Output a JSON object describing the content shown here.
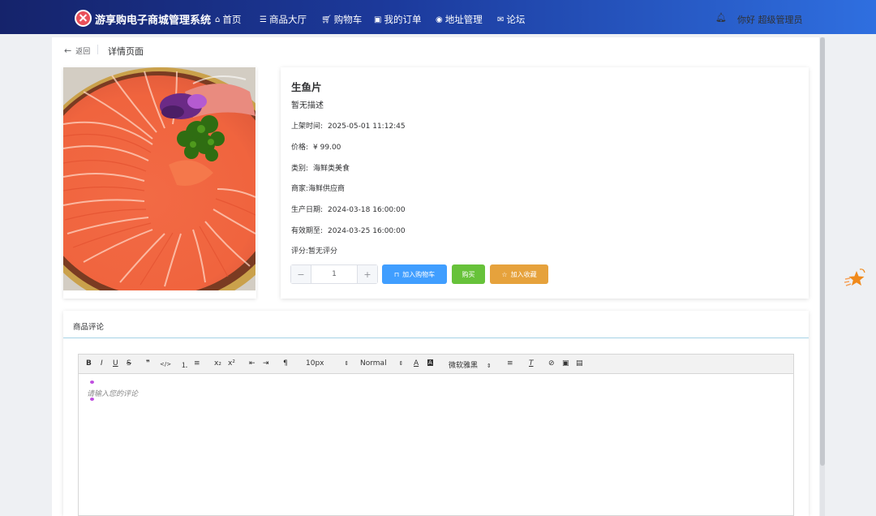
{
  "header": {
    "brand": "游享购电子商城管理系统",
    "nav": [
      {
        "label": "首页",
        "icon": "home-icon"
      },
      {
        "label": "商品大厅",
        "icon": "list-icon"
      },
      {
        "label": "购物车",
        "icon": "cart-icon"
      },
      {
        "label": "我的订单",
        "icon": "orders-icon"
      },
      {
        "label": "地址管理",
        "icon": "location-icon"
      },
      {
        "label": "论坛",
        "icon": "mail-icon"
      }
    ],
    "greeting": "你好 超级管理员"
  },
  "breadcrumb": {
    "back": "返回",
    "title": "详情页面"
  },
  "product": {
    "name": "生鱼片",
    "description": "暂无描述",
    "fields": [
      {
        "label": "上架时间:",
        "value": "2025-05-01 11:12:45"
      },
      {
        "label": "价格:",
        "value": "¥ 99.00"
      },
      {
        "label": "类别:",
        "value": "海鲜类美食"
      },
      {
        "label": "商家:",
        "value": "海鲜供应商"
      },
      {
        "label": "生产日期:",
        "value": "2024-03-18 16:00:00"
      },
      {
        "label": "有效期至:",
        "value": "2024-03-25 16:00:00"
      },
      {
        "label": "评分:",
        "value": "暂无评分"
      }
    ],
    "quantity": "1"
  },
  "actions": {
    "minus": "−",
    "plus": "+",
    "add_to_cart": "加入购物车",
    "buy": "购买",
    "favorite": "加入收藏"
  },
  "comments": {
    "title": "商品评论",
    "placeholder": "请输入您的评论",
    "toolbar": {
      "bold": "B",
      "italic": "I",
      "underline": "U",
      "strike": "S",
      "blockquote": "❞",
      "code": "</>",
      "ordered_list": "⒈",
      "bullet_list": "≡",
      "subscript": "x₂",
      "superscript": "x²",
      "outdent": "⇤",
      "indent": "⇥",
      "direction": "¶",
      "size": "10px",
      "header": "Normal",
      "font": "微软雅黑"
    }
  },
  "colors": {
    "primary": "#409eff",
    "success": "#67c23a",
    "warning": "#e6a23c",
    "nav_start": "#15236b",
    "nav_end": "#2f6fe0"
  }
}
